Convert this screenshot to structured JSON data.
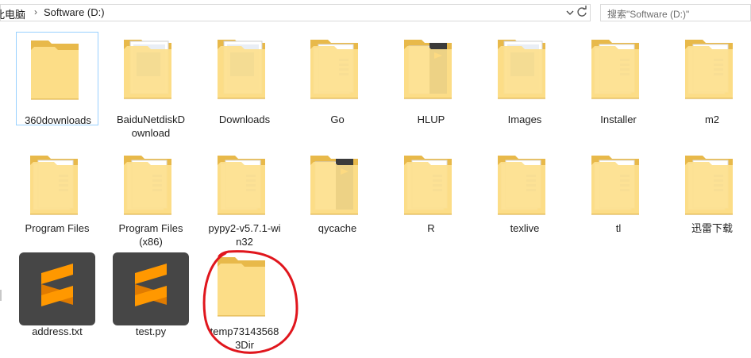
{
  "address": {
    "crumb_root": "此电脑",
    "crumb_current": "Software (D:)",
    "separator": "›"
  },
  "search": {
    "placeholder": "搜索\"Software (D:)\""
  },
  "icons": {
    "dropdown": "chevron-down-icon",
    "refresh": "refresh-icon"
  },
  "items": [
    {
      "label": "360downloads",
      "kind": "folder",
      "selected": true
    },
    {
      "label": "BaiduNetdiskD\nownload",
      "kind": "folder-image"
    },
    {
      "label": "Downloads",
      "kind": "folder-image"
    },
    {
      "label": "Go",
      "kind": "folder-doc"
    },
    {
      "label": "HLUP",
      "kind": "folder-app"
    },
    {
      "label": "Images",
      "kind": "folder-image"
    },
    {
      "label": "Installer",
      "kind": "folder-doc"
    },
    {
      "label": "m2",
      "kind": "folder-doc"
    },
    {
      "label": "Program Files",
      "kind": "folder-doc"
    },
    {
      "label": "Program Files\n(x86)",
      "kind": "folder-doc"
    },
    {
      "label": "pypy2-v5.7.1-wi\nn32",
      "kind": "folder-doc"
    },
    {
      "label": "qycache",
      "kind": "folder-app"
    },
    {
      "label": "R",
      "kind": "folder-doc"
    },
    {
      "label": "texlive",
      "kind": "folder-doc"
    },
    {
      "label": "tl",
      "kind": "folder-doc"
    },
    {
      "label": "迅雷下载",
      "kind": "folder-doc"
    },
    {
      "label": "address.txt",
      "kind": "sublime-file"
    },
    {
      "label": "test.py",
      "kind": "sublime-file"
    },
    {
      "label": "temp73143568\n3Dir",
      "kind": "folder"
    }
  ],
  "colors": {
    "folder_back": "#e8b94a",
    "folder_front": "#fde08c",
    "sublime_bg": "#464646",
    "sublime_logo": "#ff9800",
    "annotation": "#e0161d",
    "selection": "#99d1ff"
  }
}
